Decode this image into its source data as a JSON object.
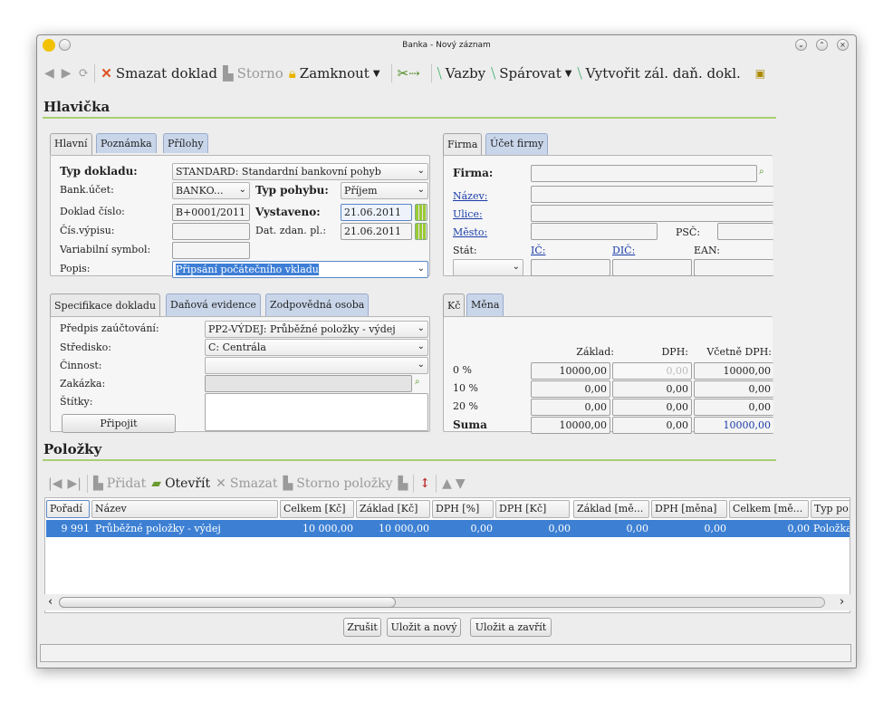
{
  "window": {
    "title": "Banka - Nový záznam"
  },
  "toolbar": {
    "smazat": "Smazat doklad",
    "storno": "Storno",
    "zamknout": "Zamknout",
    "vazby": "Vazby",
    "sparovat": "Spárovat",
    "vytvorit": "Vytvořit zál. daň. dokl."
  },
  "hlavicka": {
    "title": "Hlavička"
  },
  "tabs_left": [
    "Hlavní",
    "Poznámka",
    "Přílohy"
  ],
  "tabs_right": [
    "Firma",
    "Účet firmy"
  ],
  "form": {
    "typ_dokladu_label": "Typ dokladu:",
    "typ_dokladu_value": "STANDARD: Standardní bankovní pohyb",
    "bank_ucet_label": "Bank.účet:",
    "bank_ucet_value": "BANKO...",
    "typ_pohybu_label": "Typ pohybu:",
    "typ_pohybu_value": "Příjem",
    "doklad_cislo_label": "Doklad číslo:",
    "doklad_cislo_value": "B+0001/2011",
    "vystaveno_label": "Vystaveno:",
    "vystaveno_value": "21.06.2011",
    "cis_vypisu_label": "Čís.výpisu:",
    "dat_zdan_label": "Dat. zdan. pl.:",
    "dat_zdan_value": "21.06.2011",
    "var_symbol_label": "Variabilní symbol:",
    "popis_label": "Popis:",
    "popis_value": "Připsání počátečního vkladu"
  },
  "firma": {
    "firma_label": "Firma:",
    "nazev": "Název:",
    "ulice": "Ulice:",
    "mesto": "Město:",
    "psc": "PSČ:",
    "stat": "Stát:",
    "ic": "IČ:",
    "dic": "DIČ:",
    "ean": "EAN:"
  },
  "spec_tabs": [
    "Specifikace dokladu",
    "Daňová evidence",
    "Zodpovědná osoba"
  ],
  "spec": {
    "predpis_label": "Předpis zaúčtování:",
    "predpis_value": "PP2-VÝDEJ: Průběžné položky - výdej",
    "stredisko_label": "Středisko:",
    "stredisko_value": "C: Centrála",
    "cinnost_label": "Činnost:",
    "zakazka_label": "Zakázka:",
    "stitky_label": "Štítky:",
    "pripojit": "Připojit"
  },
  "vat_tabs": [
    "Kč",
    "Měna"
  ],
  "vat": {
    "headers": [
      "Základ:",
      "DPH:",
      "Včetně DPH:"
    ],
    "rows": [
      {
        "label": "0 %",
        "zaklad": "10000,00",
        "dph": "0,00",
        "vcetne": "10000,00"
      },
      {
        "label": "10 %",
        "zaklad": "0,00",
        "dph": "0,00",
        "vcetne": "0,00"
      },
      {
        "label": "20 %",
        "zaklad": "0,00",
        "dph": "0,00",
        "vcetne": "0,00"
      }
    ],
    "suma": {
      "label": "Suma",
      "zaklad": "10000,00",
      "dph": "0,00",
      "vcetne": "10000,00"
    }
  },
  "polozky": {
    "title": "Položky",
    "pridat": "Přidat",
    "otevrit": "Otevřít",
    "smazat": "Smazat",
    "storno": "Storno položky"
  },
  "table": {
    "headers": [
      "Pořadí",
      "Název",
      "Celkem [Kč]",
      "Základ [Kč]",
      "DPH [%]",
      "DPH [Kč]",
      "Základ [mě...",
      "DPH [měna]",
      "Celkem [mě...",
      "Typ po"
    ],
    "row": [
      "9 991",
      "Průběžné položky - výdej",
      "10 000,00",
      "10 000,00",
      "0,00",
      "0,00",
      "0,00",
      "0,00",
      "0,00",
      "Položka"
    ]
  },
  "buttons": {
    "zrusit": "Zrušit",
    "ulozit_novy": "Uložit a nový",
    "ulozit_zavrit": "Uložit a zavřít"
  }
}
